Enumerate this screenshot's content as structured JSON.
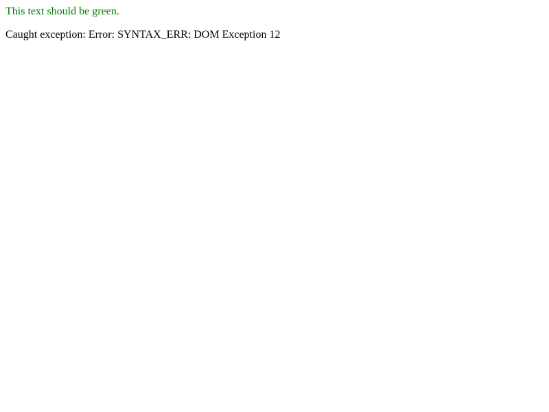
{
  "messages": {
    "green_text": "This text should be green.",
    "exception_text": "Caught exception: Error: SYNTAX_ERR: DOM Exception 12"
  },
  "colors": {
    "green": "#008000",
    "default_text": "#000000",
    "background": "#ffffff"
  }
}
